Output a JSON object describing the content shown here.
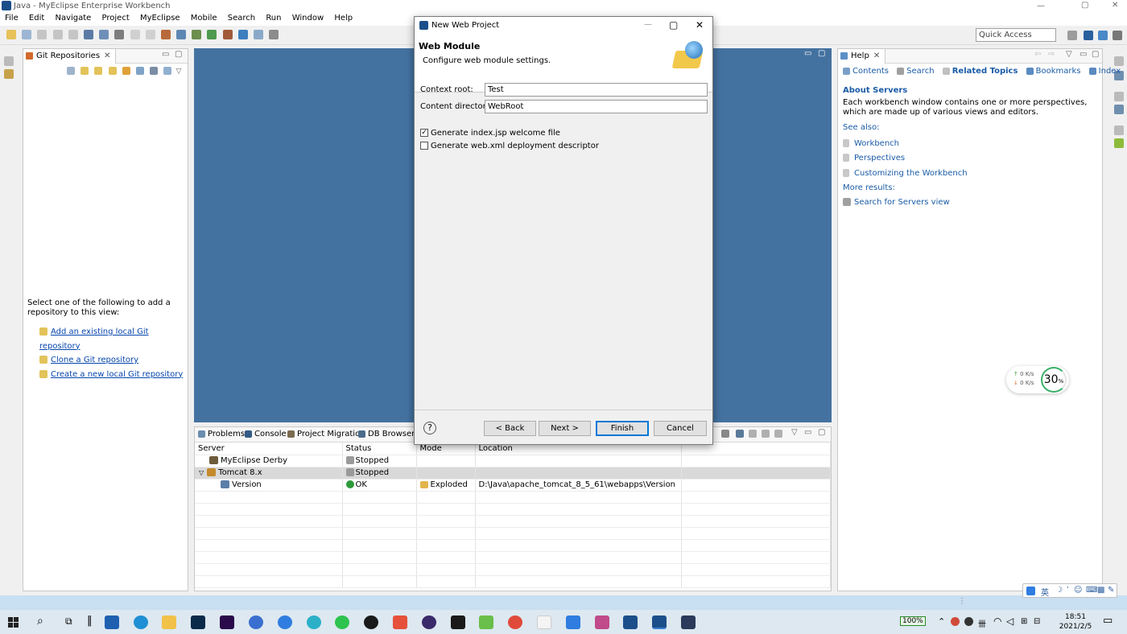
{
  "window": {
    "title": "Java - MyEclipse Enterprise Workbench"
  },
  "menu": [
    "File",
    "Edit",
    "Navigate",
    "Project",
    "MyEclipse",
    "Mobile",
    "Search",
    "Run",
    "Window",
    "Help"
  ],
  "quick_access": "Quick Access",
  "git": {
    "tab": "Git Repositories",
    "message": "Select one of the following to add a repository to this view:",
    "links": [
      "Add an existing local Git repository",
      "Clone a Git repository",
      "Create a new local Git repository"
    ]
  },
  "dialog": {
    "title": "New Web Project",
    "heading": "Web Module",
    "subheading": "Configure web module settings.",
    "context_root_label": "Context root:",
    "context_root_value": "Test",
    "content_dir_label": "Content directory:",
    "content_dir_value": "WebRoot",
    "opt1": "Generate index.jsp welcome file",
    "opt1_checked": true,
    "opt2": "Generate web.xml deployment descriptor",
    "opt2_checked": false,
    "back": "< Back",
    "next": "Next >",
    "finish": "Finish",
    "cancel": "Cancel"
  },
  "bottom_tabs": [
    "Problems",
    "Console",
    "Project Migration",
    "DB Browser"
  ],
  "servers": {
    "columns": [
      "Server",
      "Status",
      "Mode",
      "Location"
    ],
    "rows": [
      {
        "server": "MyEclipse Derby",
        "status": "Stopped",
        "mode": "",
        "location": ""
      },
      {
        "server": "Tomcat  8.x",
        "status": "Stopped",
        "mode": "",
        "location": ""
      },
      {
        "server": "Version",
        "status": "OK",
        "mode": "Exploded",
        "location": "D:\\Java\\apache_tomcat_8_5_61\\webapps\\Version"
      }
    ]
  },
  "help": {
    "tab": "Help",
    "nav": [
      "Contents",
      "Search",
      "Related Topics",
      "Bookmarks",
      "Index"
    ],
    "section_title": "About Servers",
    "description": "Each workbench window contains one or more perspectives, which are made up of various views and editors.",
    "see_also": "See also:",
    "links": [
      "Workbench",
      "Perspectives",
      "Customizing the Workbench"
    ],
    "more_results": "More results:",
    "search_link": "Search for Servers view"
  },
  "netmon": {
    "up": "0",
    "down": "0",
    "unit": "K/s",
    "percent": "30",
    "percent_sign": "%"
  },
  "tray": {
    "ime": "英",
    "battery": "100%",
    "time": "18:51",
    "date": "2021/2/5"
  },
  "colors": {
    "editor_bg": "#4472a0",
    "link": "#0645ad",
    "help_title": "#1a5ba6"
  }
}
